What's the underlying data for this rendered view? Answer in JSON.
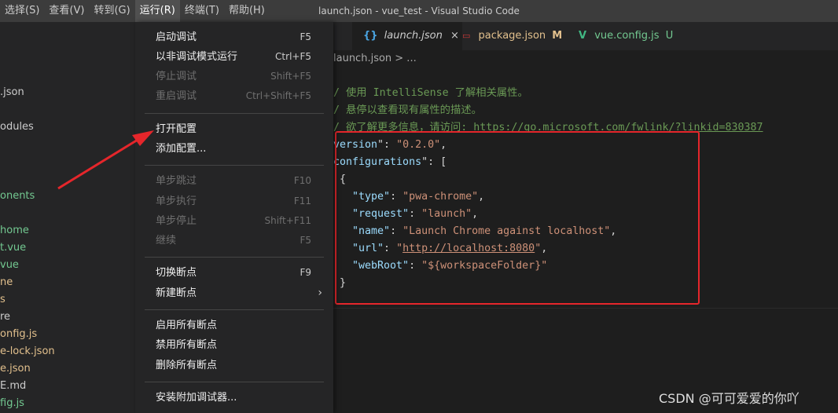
{
  "window": {
    "title": "launch.json - vue_test - Visual Studio Code"
  },
  "menubar": {
    "items": [
      {
        "label": "选择(S)"
      },
      {
        "label": "查看(V)"
      },
      {
        "label": "转到(G)"
      },
      {
        "label": "运行(R)"
      },
      {
        "label": "终端(T)"
      },
      {
        "label": "帮助(H)"
      }
    ]
  },
  "run_menu": {
    "items": [
      {
        "label": "启动调试",
        "shortcut": "F5",
        "enabled": true
      },
      {
        "label": "以非调试模式运行",
        "shortcut": "Ctrl+F5",
        "enabled": true
      },
      {
        "label": "停止调试",
        "shortcut": "Shift+F5",
        "enabled": false
      },
      {
        "label": "重启调试",
        "shortcut": "Ctrl+Shift+F5",
        "enabled": false
      },
      {
        "label": "打开配置",
        "shortcut": "",
        "enabled": true
      },
      {
        "label": "添加配置...",
        "shortcut": "",
        "enabled": true
      },
      {
        "label": "单步跳过",
        "shortcut": "F10",
        "enabled": false
      },
      {
        "label": "单步执行",
        "shortcut": "F11",
        "enabled": false
      },
      {
        "label": "单步停止",
        "shortcut": "Shift+F11",
        "enabled": false
      },
      {
        "label": "继续",
        "shortcut": "F5",
        "enabled": false
      },
      {
        "label": "切换断点",
        "shortcut": "F9",
        "enabled": true
      },
      {
        "label": "新建断点",
        "shortcut": "",
        "enabled": true,
        "submenu_glyph": "›"
      },
      {
        "label": "启用所有断点",
        "shortcut": "",
        "enabled": true
      },
      {
        "label": "禁用所有断点",
        "shortcut": "",
        "enabled": true
      },
      {
        "label": "删除所有断点",
        "shortcut": "",
        "enabled": true
      },
      {
        "label": "安装附加调试器...",
        "shortcut": "",
        "enabled": true
      }
    ]
  },
  "sidebar": {
    "entries": [
      {
        "text": ".json",
        "color": "#cccccc"
      },
      {
        "text": "odules",
        "color": "#cccccc"
      },
      {
        "text": "onents",
        "color": "#73c991"
      },
      {
        "text": " home",
        "color": "#73c991"
      },
      {
        "text": "t.vue",
        "color": "#73c991"
      },
      {
        "text": "vue",
        "color": "#73c991"
      },
      {
        "text": "ne",
        "color": "#e2c08d"
      },
      {
        "text": "s",
        "color": "#e2c08d"
      },
      {
        "text": "re",
        "color": "#cccccc"
      },
      {
        "text": "onfig.js",
        "color": "#e2c08d"
      },
      {
        "text": "e-lock.json",
        "color": "#e2c08d"
      },
      {
        "text": "e.json",
        "color": "#e2c08d"
      },
      {
        "text": "E.md",
        "color": "#cccccc"
      },
      {
        "text": "fig.js",
        "color": "#73c991"
      }
    ]
  },
  "tabs": [
    {
      "icon": "{}",
      "label": "launch.json",
      "close": "×",
      "color": "#cccccc",
      "icon_color": "#4aa3df"
    },
    {
      "icon": "▭",
      "label": "package.json",
      "status": "M",
      "color": "#e2c08d",
      "icon_color": "#cb3837"
    },
    {
      "icon": "V",
      "label": "vue.config.js",
      "status": "U",
      "color": "#73c991",
      "icon_color": "#41b883"
    }
  ],
  "breadcrumb": {
    "text": "launch.json > ..."
  },
  "editor": {
    "lines": [
      {
        "parts": [
          {
            "t": "/ 使用 IntelliSense 了解相关属性。",
            "c": "c-comment"
          }
        ]
      },
      {
        "parts": [
          {
            "t": "/ 悬停以查看现有属性的描述。",
            "c": "c-comment"
          }
        ]
      },
      {
        "parts": [
          {
            "t": "/ 欲了解更多信息，请访问: ",
            "c": "c-comment"
          },
          {
            "t": "https://go.microsoft.com/fwlink/?linkid=830387",
            "c": "c-comment-link"
          }
        ]
      },
      {
        "parts": [
          {
            "t": "version",
            "c": "c-key"
          },
          {
            "t": "\": ",
            "c": "c-punc"
          },
          {
            "t": "\"0.2.0\"",
            "c": "c-str"
          },
          {
            "t": ",",
            "c": "c-punc"
          }
        ]
      },
      {
        "parts": [
          {
            "t": "configurations",
            "c": "c-key"
          },
          {
            "t": "\": [",
            "c": "c-punc"
          }
        ]
      },
      {
        "parts": [
          {
            "t": " {",
            "c": "c-punc"
          }
        ]
      },
      {
        "parts": [
          {
            "t": "   \"type\"",
            "c": "c-key"
          },
          {
            "t": ": ",
            "c": "c-punc"
          },
          {
            "t": "\"pwa-chrome\"",
            "c": "c-str"
          },
          {
            "t": ",",
            "c": "c-punc"
          }
        ]
      },
      {
        "parts": [
          {
            "t": "   \"request\"",
            "c": "c-key"
          },
          {
            "t": ": ",
            "c": "c-punc"
          },
          {
            "t": "\"launch\"",
            "c": "c-str"
          },
          {
            "t": ",",
            "c": "c-punc"
          }
        ]
      },
      {
        "parts": [
          {
            "t": "   \"name\"",
            "c": "c-key"
          },
          {
            "t": ": ",
            "c": "c-punc"
          },
          {
            "t": "\"Launch Chrome against localhost\"",
            "c": "c-str"
          },
          {
            "t": ",",
            "c": "c-punc"
          }
        ]
      },
      {
        "parts": [
          {
            "t": "   \"url\"",
            "c": "c-key"
          },
          {
            "t": ": ",
            "c": "c-punc"
          },
          {
            "t": "\"",
            "c": "c-str"
          },
          {
            "t": "http://localhost:8080",
            "c": "c-link"
          },
          {
            "t": "\"",
            "c": "c-str"
          },
          {
            "t": ",",
            "c": "c-punc"
          }
        ]
      },
      {
        "parts": [
          {
            "t": "   \"webRoot\"",
            "c": "c-key"
          },
          {
            "t": ": ",
            "c": "c-punc"
          },
          {
            "t": "\"${workspaceFolder}\"",
            "c": "c-str"
          }
        ]
      },
      {
        "parts": [
          {
            "t": " }",
            "c": "c-punc"
          }
        ]
      }
    ]
  },
  "watermark": {
    "text": "CSDN @可可爱爱的你吖"
  },
  "colors": {
    "highlight_box": "#e5262b",
    "arrow": "#e5262b",
    "accent": "#007acc"
  }
}
